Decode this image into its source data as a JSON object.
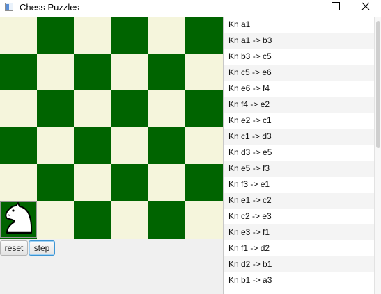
{
  "window": {
    "title": "Chess Puzzles",
    "icon": "app-window-icon",
    "controls": [
      "minimize-icon",
      "maximize-icon",
      "close-icon"
    ]
  },
  "board": {
    "size": 6,
    "colors": {
      "light": "#f5f5dc",
      "dark": "#006400"
    },
    "piece": {
      "type": "knight",
      "icon": "white-knight-icon",
      "square": "a1"
    }
  },
  "buttons": {
    "reset": "reset",
    "step": "step"
  },
  "moves": [
    "Kn a1",
    "Kn a1 -> b3",
    "Kn b3 -> c5",
    "Kn c5 -> e6",
    "Kn e6 -> f4",
    "Kn f4 -> e2",
    "Kn e2 -> c1",
    "Kn c1 -> d3",
    "Kn d3 -> e5",
    "Kn e5 -> f3",
    "Kn f3 -> e1",
    "Kn e1 -> c2",
    "Kn c2 -> e3",
    "Kn e3 -> f1",
    "Kn f1 -> d2",
    "Kn d2 -> b1",
    "Kn b1 -> a3"
  ]
}
